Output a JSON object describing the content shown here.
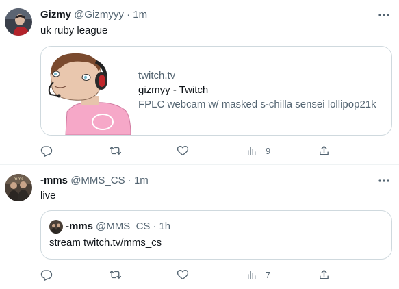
{
  "tweets": [
    {
      "display_name": "Gizmy",
      "handle": "@Gizmyyy",
      "separator": "·",
      "time": "1m",
      "text": "uk ruby league",
      "card": {
        "domain": "twitch.tv",
        "title": "gizmyy - Twitch",
        "description": "FPLC webcam w/ masked s-chilla sensei lollipop21k"
      },
      "actions": {
        "reply": "",
        "retweet": "",
        "like": "",
        "views": "9",
        "share": ""
      }
    },
    {
      "display_name": "-mms",
      "handle": "@MMS_CS",
      "separator": "·",
      "time": "1m",
      "text": "live",
      "quote": {
        "display_name": "-mms",
        "handle": "@MMS_CS",
        "separator": "·",
        "time": "1h",
        "text": "stream twitch.tv/mms_cs"
      },
      "actions": {
        "reply": "",
        "retweet": "",
        "like": "",
        "views": "7",
        "share": ""
      }
    }
  ],
  "icons": {
    "more": "more-horizontal-icon",
    "reply": "reply-icon",
    "retweet": "retweet-icon",
    "like": "heart-icon",
    "views": "bar-chart-icon",
    "share": "share-icon"
  },
  "colors": {
    "text_primary": "#0f1419",
    "text_secondary": "#536471",
    "border": "#cfd9de",
    "divider": "#eff3f4"
  }
}
